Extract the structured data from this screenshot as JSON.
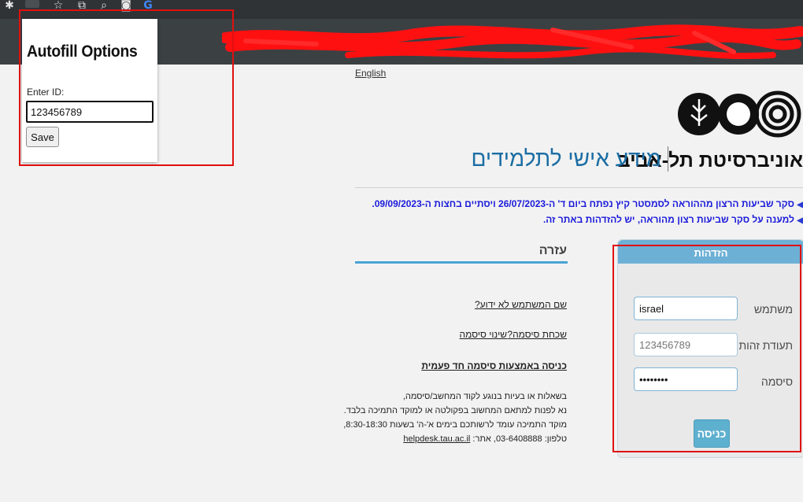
{
  "popup": {
    "title": "Autofill Options",
    "id_label": "Enter ID:",
    "id_value": "123456789",
    "save_label": "Save"
  },
  "page": {
    "english_link": "English",
    "university_name": "אוניברסיטת תל-אביב",
    "page_title": "מידע אישי לתלמידים",
    "notice_1": "סקר שביעות הרצון מההוראה לסמסטר קיץ נפתח ביום ד' ה-26/07/2023 ויסתיים בחצות ה-09/09/2023.",
    "notice_2": "למענה על סקר שביעות רצון מהוראה, יש להזדהות באתר זה."
  },
  "login": {
    "header": "הזדהות",
    "username_label": "משתמש",
    "username_value": "israel",
    "id_label": "תעודת זהות",
    "id_placeholder": "123456789",
    "password_label": "סיסמה",
    "password_value": "12345678",
    "submit_label": "כניסה"
  },
  "help": {
    "title": "עזרה",
    "forgot_username": "שם המשתמש לא ידוע?",
    "forgot_password": "שכחת סיסמה?",
    "change_password": "שינוי סיסמה",
    "otp_login": "כניסה באמצעות סיסמה חד פעמית",
    "info_line_1": "בשאלות או בעיות בנוגע לקוד המחשב/סיסמה,",
    "info_line_2": "נא לפנות למתאם המחשוב בפקולטה או למוקד התמיכה בלבד.",
    "info_line_3": "מוקד התמיכה עומד לרשותכם בימים א'-ה' בשעות 8:30-18:30,",
    "info_phone": "טלפון: 03-6408888, אתר: ",
    "info_site": "helpdesk.tau.ac.il"
  },
  "colors": {
    "accent": "#1c6ea4",
    "login_header": "#6db0d6",
    "annotation_red": "#e01010"
  }
}
